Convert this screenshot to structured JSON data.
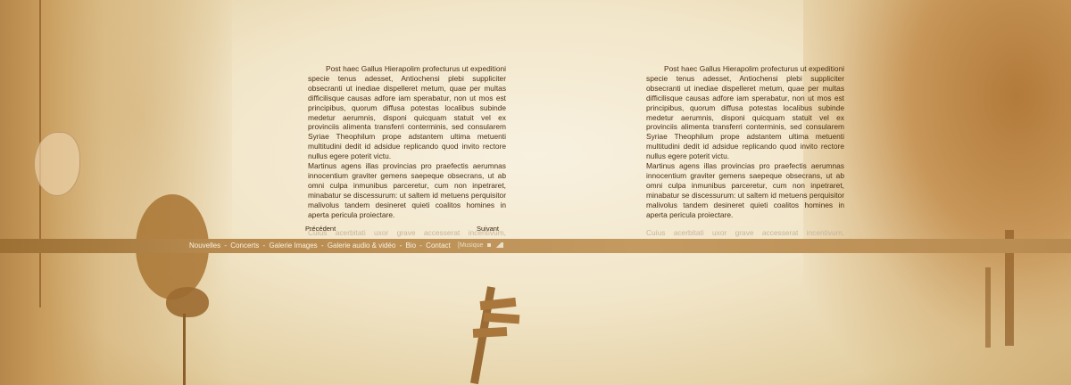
{
  "columns": {
    "left": {
      "paragraph_1": "Post haec Gallus Hierapolim profecturus ut expeditioni specie tenus adesset, Antiochensi plebi suppliciter obsecranti ut inediae dispelleret metum, quae per multas difficilisque causas adfore iam sperabatur, non ut mos est principibus, quorum diffusa potestas localibus subinde medetur aerumnis, disponi quicquam statuit vel ex provinciis alimenta transferri conterminis, sed consularem Syriae Theophilum prope adstantem ultima metuenti multitudini dedit id adsidue replicando quod invito rectore nullus egere poterit victu.",
      "paragraph_2": "Martinus agens illas provincias pro praefectis aerumnas innocentium graviter gemens saepeque obsecrans, ut ab omni culpa inmunibus parceretur, cum non inpetraret, minabatur se discessurum: ut saltem id metuens perquisitor malivolus tandem desineret quieti coalitos homines in aperta pericula proiectare.",
      "paragraph_faded": "Cuius acerbitati uxor grave accesserat incentivum, germanitate"
    },
    "right": {
      "paragraph_1": "Post haec Gallus Hierapolim profecturus ut expeditioni specie tenus adesset, Antiochensi plebi suppliciter obsecranti ut inediae dispelleret metum, quae per multas difficilisque causas adfore iam sperabatur, non ut mos est principibus, quorum diffusa potestas localibus subinde medetur aerumnis, disponi quicquam statuit vel ex provinciis alimenta transferri conterminis, sed consularem Syriae Theophilum prope adstantem ultima metuenti multitudini dedit id adsidue replicando quod invito rectore nullus egere poterit victu.",
      "paragraph_2": "Martinus agens illas provincias pro praefectis aerumnas innocentium graviter gemens saepeque obsecrans, ut ab omni culpa inmunibus parceretur, cum non inpetraret, minabatur se discessurum: ut saltem id metuens perquisitor malivolus tandem desineret quieti coalitos homines in aperta pericula proiectare.",
      "paragraph_faded": "Cuius acerbitati uxor grave accesserat incentivum, germanitate"
    }
  },
  "pager": {
    "prev_label": "Précédent",
    "next_label": "Suivant"
  },
  "menu": {
    "items": [
      "Nouvelles",
      "Concerts",
      "Galerie Images",
      "Galerie audio & vidéo",
      "Bio",
      "Contact"
    ],
    "separator": "-"
  },
  "music": {
    "label": "[Musique"
  },
  "colors": {
    "menubar": "#b78a4f",
    "text": "#4a2d10",
    "menu_text": "#fbf2df"
  }
}
